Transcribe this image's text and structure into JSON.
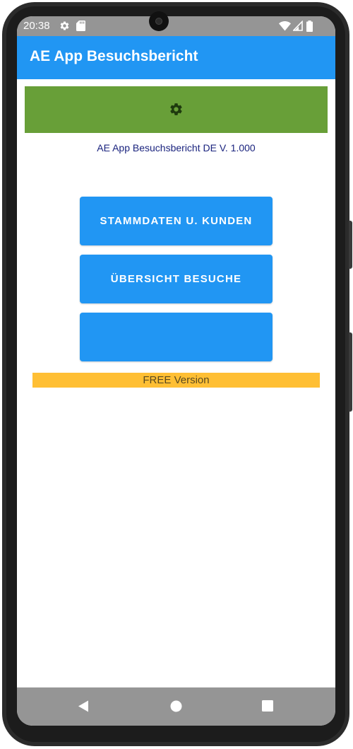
{
  "statusbar": {
    "time": "20:38",
    "icons": [
      "settings-icon",
      "sd-card-icon",
      "wifi-icon",
      "signal-icon",
      "battery-icon"
    ]
  },
  "appbar": {
    "title": "AE App Besuchsbericht"
  },
  "settings_banner": {
    "icon": "gear-icon",
    "color": "#689f38"
  },
  "version_label": "AE App Besuchsbericht DE V. 1.000",
  "buttons": {
    "stammdaten": "STAMMDATEN U. KUNDEN",
    "uebersicht": "ÜBERSICHT BESUCHE",
    "third": ""
  },
  "free_label": "FREE Version",
  "navbar": {
    "icons": [
      "back-icon",
      "home-icon",
      "recents-icon"
    ]
  },
  "colors": {
    "primary": "#2196f3",
    "settings_green": "#689f38",
    "free_banner": "#ffbf34",
    "version_text": "#1a237e"
  }
}
